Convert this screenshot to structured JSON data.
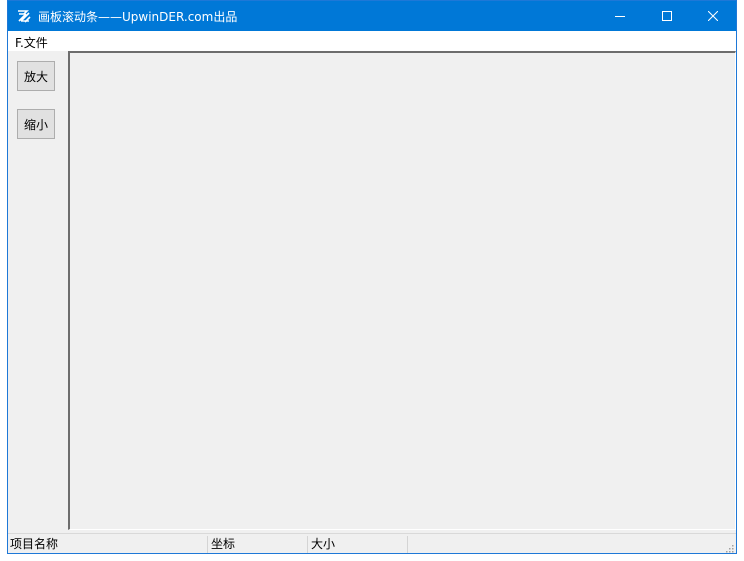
{
  "window": {
    "title": "画板滚动条——UpwinDER.com出品",
    "accent": "#0078d7",
    "icons": {
      "app": "app-logo-icon",
      "minimize": "minimize-icon",
      "maximize": "maximize-icon",
      "close": "close-icon"
    }
  },
  "menu": {
    "file_label": "F.文件"
  },
  "toolbar": {
    "zoom_in_label": "放大",
    "zoom_out_label": "缩小"
  },
  "status": {
    "panels": [
      "项目名称",
      "坐标",
      "大小"
    ]
  }
}
